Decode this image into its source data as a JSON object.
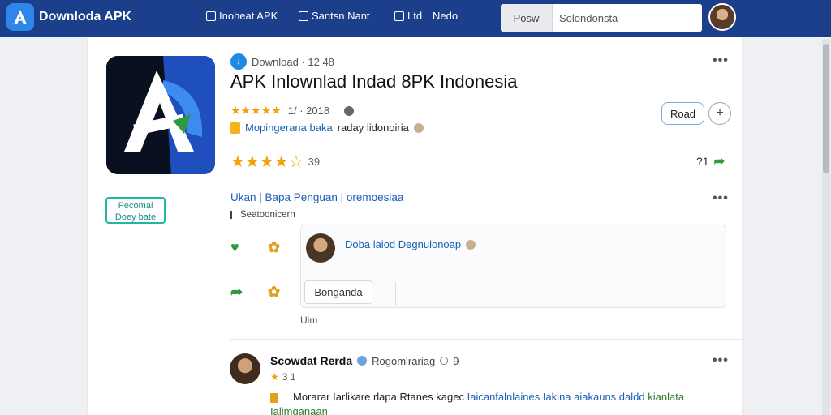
{
  "header": {
    "brand_name": "Downloda APK",
    "nav": [
      {
        "label": "Inoheat APK",
        "icon": "square-icon"
      },
      {
        "label": "Santsn Nant",
        "icon": "image-icon"
      },
      {
        "label": "Ltd",
        "icon": "grid-icon"
      },
      {
        "label": "Nedo",
        "icon": ""
      }
    ],
    "search": {
      "button_label": "Posw",
      "value": "Solondonsta"
    }
  },
  "app": {
    "download_line": "Download · 12 48",
    "title": "APK Inlownlad Indad 8PK Indonesia",
    "rating_stars": "★★★★★",
    "rating_text": "1/ · 2018",
    "desc_blue": "Mopingerana baka",
    "desc_black": "raday lidonoiria",
    "big_stars": "★★★★☆",
    "review_count": "39",
    "read_label": "Road",
    "plus_label": "+",
    "share_count": "?1"
  },
  "side_badge": {
    "line1": "Pecomal",
    "line2": "Doey bate"
  },
  "section": {
    "tabs": "Ukan | Bapa  Penguan | oremoesiaa",
    "sub": "Seatoonicern",
    "comment_name": "Doba laiod Degnulonoap",
    "comment_button": "Bonganda",
    "under_label": "Uim"
  },
  "post": {
    "name": "Scowdat Rerda",
    "handle": "Rogomlrariag",
    "time": "9",
    "stats": "3 1",
    "body_black": "Morarar Iarlikare rlapa Rtanes kagec",
    "body_blue": "Iaicanfalnlaines Iakina aiakauns daldd",
    "body_green": "kianlata Ialimganaan"
  },
  "colors": {
    "topbar": "#1c3f8c",
    "accent_blue": "#1a5fb4",
    "star": "#f2a20a",
    "green": "#2e9a3e",
    "teal": "#21b5a5"
  }
}
